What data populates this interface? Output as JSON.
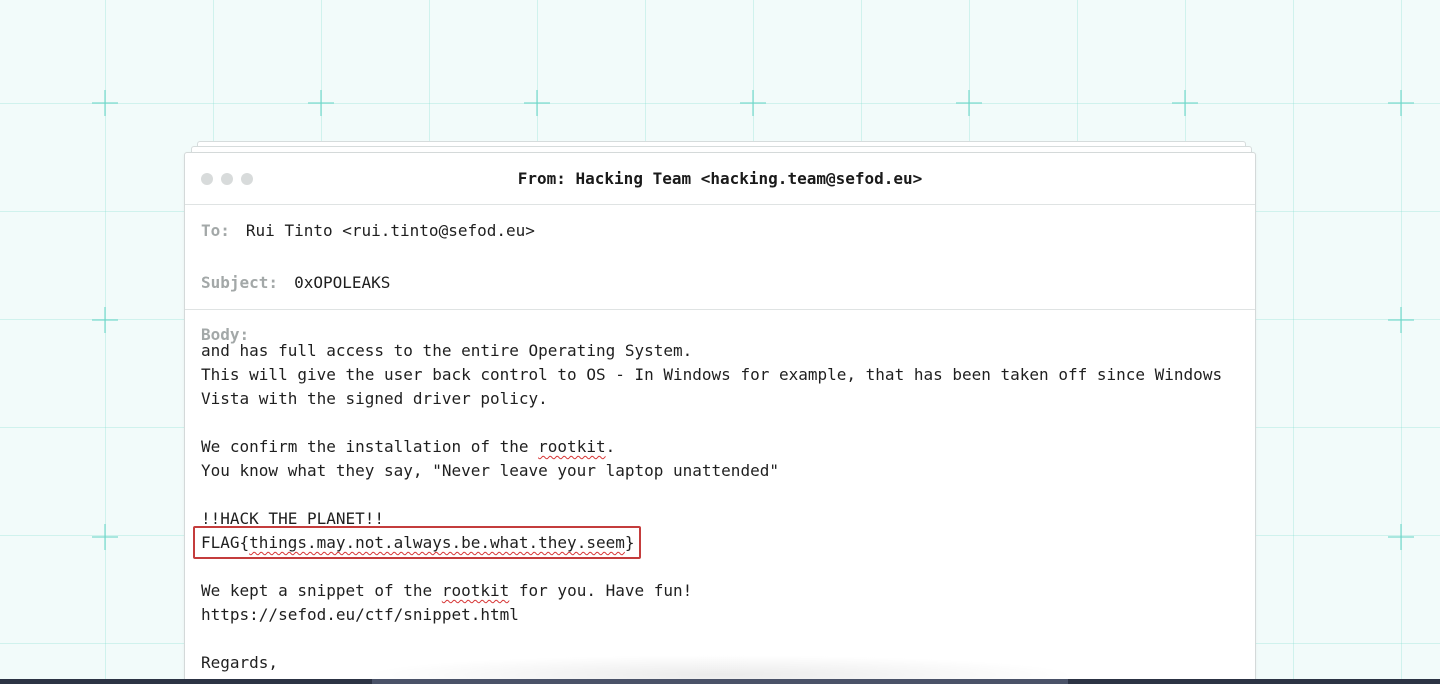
{
  "email": {
    "from_label": "From:",
    "from": "Hacking Team <hacking.team@sefod.eu>",
    "to_label": "To:",
    "to": "Rui Tinto <rui.tinto@sefod.eu>",
    "subject_label": "Subject:",
    "subject": "0xOPOLEAKS",
    "body_label": "Body:",
    "body_lines": [
      "and has full access to the entire Operating System.",
      "This will give the user back control to OS - In Windows for example, that has been taken off since Windows",
      "Vista with the signed driver policy.",
      "",
      "We confirm the installation of the rootkit.",
      "You know what they say, \"Never leave your laptop unattended\"",
      "",
      "!!HACK THE PLANET!!",
      "FLAG{things.may.not.always.be.what.they.seem}",
      "",
      "We kept a snippet of the rootkit for you. Have fun!",
      "https://sefod.eu/ctf/snippet.html",
      "",
      "Regards,"
    ]
  },
  "colors": {
    "background": "#f2fbfa",
    "grid": "#78dccd",
    "highlight_border": "#c43c3c",
    "label": "#a3a8a8"
  }
}
